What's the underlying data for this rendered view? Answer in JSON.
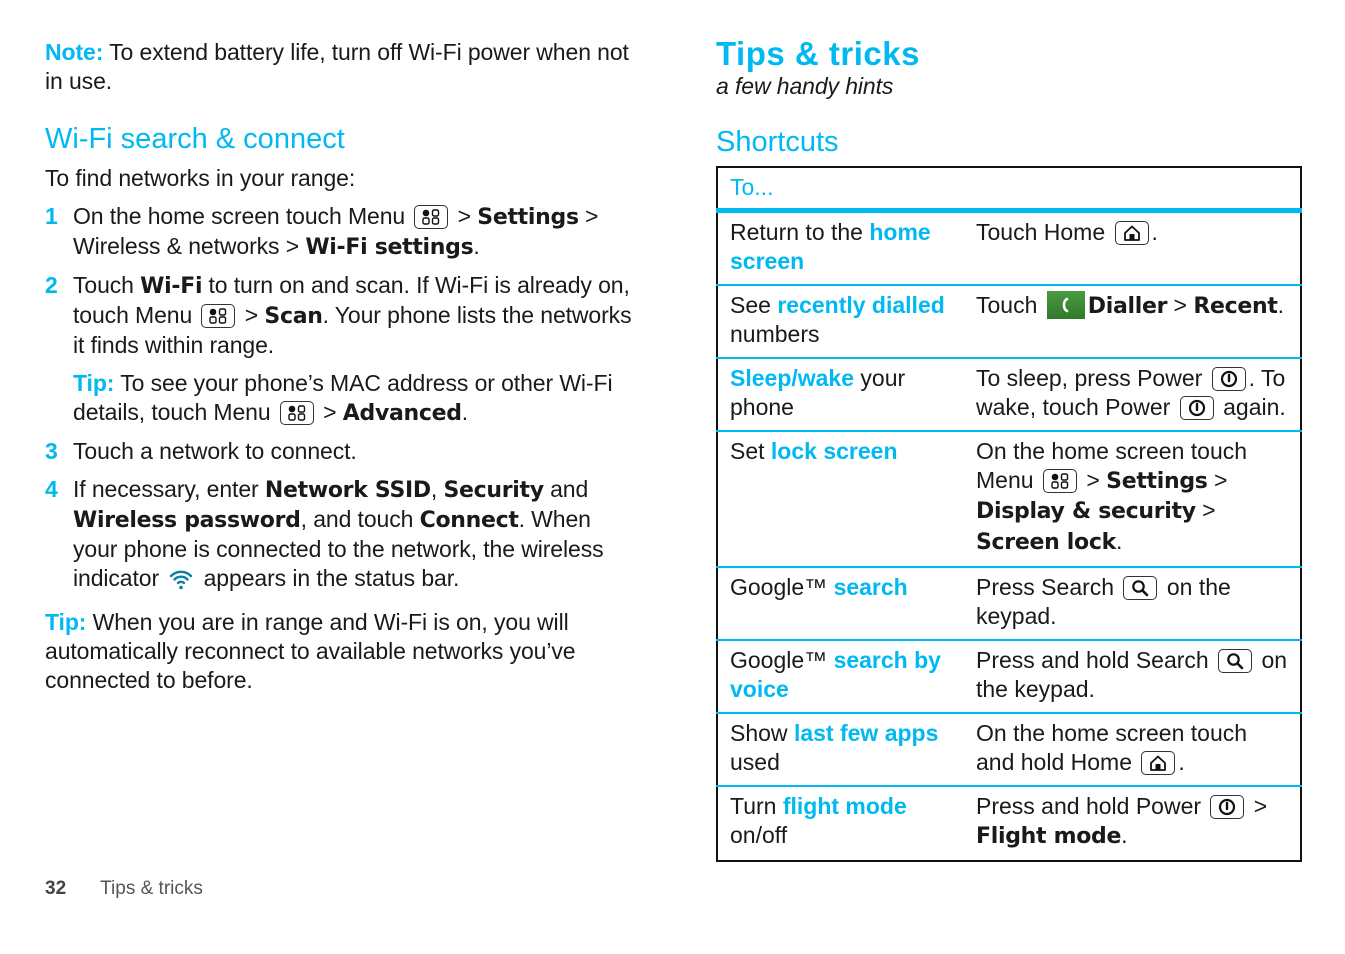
{
  "left": {
    "note": {
      "label": "Note:",
      "text": " To extend battery life, turn off Wi-Fi power when not in use."
    },
    "section_title": "Wi-Fi search & connect",
    "intro": "To find networks in your range:",
    "steps": [
      {
        "num": "1",
        "t1": "On the home screen touch Menu ",
        "t2": " > ",
        "b1": "Settings",
        "t3": " > Wireless & networks > ",
        "b2": "Wi-Fi settings",
        "t4": "."
      },
      {
        "num": "2",
        "t1": "Touch ",
        "b1": "Wi-Fi",
        "t2": " to turn on and scan. If Wi-Fi is already on, touch Menu ",
        "t3": " > ",
        "b2": "Scan",
        "t4": ". Your phone lists the networks it finds within range."
      },
      {
        "num": "3",
        "t1": "Touch a network to connect."
      },
      {
        "num": "4",
        "t1": "If necessary, enter ",
        "b1": "Network SSID",
        "t2": ", ",
        "b2": "Security",
        "t3": " and ",
        "b3": "Wireless password",
        "t4": ", and touch ",
        "b4": "Connect",
        "t5": ". When your phone is connected to the network, the wireless indicator ",
        "t6": " appears in the status bar."
      }
    ],
    "step2_tip": {
      "label": "Tip:",
      "t1": " To see your phone’s MAC address or other Wi-Fi details, touch Menu ",
      "t2": " > ",
      "b1": "Advanced",
      "t3": "."
    },
    "tip": {
      "label": "Tip:",
      "text": " When you are in range and Wi-Fi is on, you will automatically reconnect to available networks you’ve connected to before."
    }
  },
  "right": {
    "title": "Tips & tricks",
    "subtitle": "a few handy hints",
    "section_title": "Shortcuts",
    "table_header": "To...",
    "rows": [
      {
        "a1": "Return to the ",
        "ah": "home screen",
        "a2": "",
        "b1": "Touch Home ",
        "b2": "."
      },
      {
        "a1": "See ",
        "ah": "recently dialled",
        "a2": " numbers",
        "b1": "Touch ",
        "bb1": "Dialler",
        "b2": " > ",
        "bb2": "Recent",
        "b3": "."
      },
      {
        "a1": "",
        "ah": "Sleep/wake",
        "a2": " your phone",
        "b1": "To sleep, press Power ",
        "b2": ". To wake, touch Power ",
        "b3": " again."
      },
      {
        "a1": "Set ",
        "ah": "lock screen",
        "a2": "",
        "b1": "On the home screen touch Menu ",
        "b2": " > ",
        "bb1": "Settings",
        "b3": " > ",
        "bb2": "Display & security",
        "b4": " > ",
        "bb3": "Screen lock",
        "b5": "."
      },
      {
        "a1": "Google™ ",
        "ah": "search",
        "a2": "",
        "b1": "Press Search ",
        "b2": " on the keypad."
      },
      {
        "a1": "Google™ ",
        "ah": "search by voice",
        "a2": "",
        "b1": "Press and hold Search ",
        "b2": " on the keypad."
      },
      {
        "a1": "Show ",
        "ah": "last few apps",
        "a2": " used",
        "b1": "On the home screen touch and hold Home ",
        "b2": "."
      },
      {
        "a1": "Turn ",
        "ah": "flight mode",
        "a2": " on/off",
        "b1": "Press and hold Power ",
        "b2": " > ",
        "bb1": "Flight mode",
        "b3": "."
      }
    ]
  },
  "footer": {
    "page_number": "32",
    "section": "Tips & tricks"
  },
  "colors": {
    "accent": "#00b9f1",
    "text": "#1a1a1a",
    "dialer_green": "#3a8a34"
  }
}
